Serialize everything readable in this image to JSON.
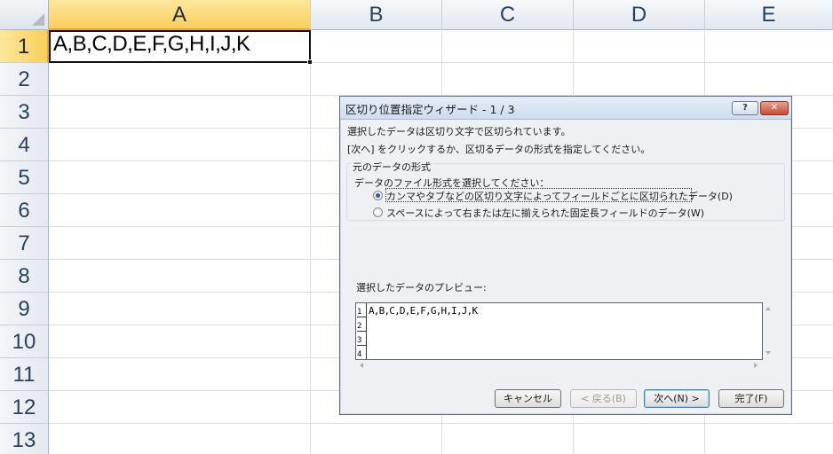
{
  "sheet": {
    "columns": [
      "A",
      "B",
      "C",
      "D",
      "E"
    ],
    "rows": [
      "1",
      "2",
      "3",
      "4",
      "5",
      "6",
      "7",
      "8",
      "9",
      "10",
      "11",
      "12",
      "13"
    ],
    "selected_column": "A",
    "selected_row": "1",
    "cell_A1": "A,B,C,D,E,F,G,H,I,J,K"
  },
  "dialog": {
    "title": "区切り位置指定ウィザード - 1 / 3",
    "help_button": "?",
    "close_button": "✕",
    "desc_line1": "選択したデータは区切り文字で区切られています。",
    "desc_line2": "[次へ] をクリックするか、区切るデータの形式を指定してください。",
    "group_label": "元のデータの形式",
    "group_prompt": "データのファイル形式を選択してください：",
    "options": [
      {
        "label": "カンマやタブなどの区切り文字によってフィールドごとに区切られたデータ(D)",
        "checked": true
      },
      {
        "label": "スペースによって右または左に揃えられた固定長フィールドのデータ(W)",
        "checked": false
      }
    ],
    "preview_label": "選択したデータのプレビュー:",
    "preview_row_numbers": [
      "1",
      "2",
      "3",
      "4"
    ],
    "preview_lines": [
      "A,B,C,D,E,F,G,H,I,J,K"
    ],
    "buttons": {
      "cancel": "キャンセル",
      "back": "< 戻る(B)",
      "next": "次へ(N) >",
      "finish": "完了(F)"
    }
  }
}
